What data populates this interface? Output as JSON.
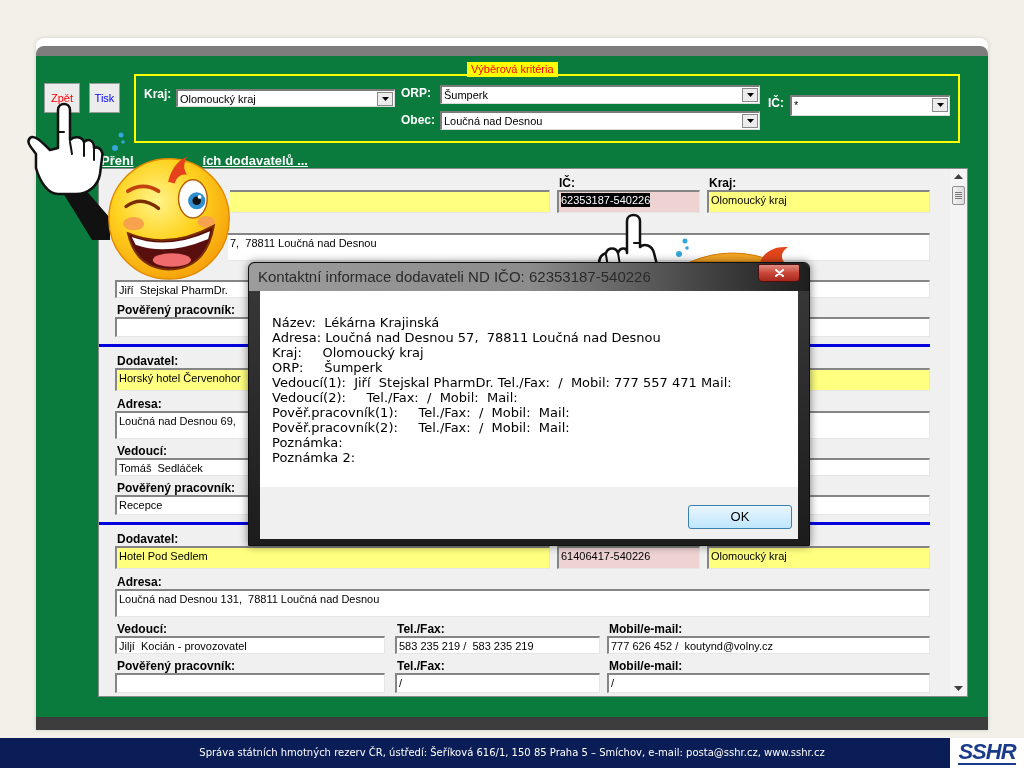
{
  "toolbar": {
    "buttons": [
      {
        "kind": "back",
        "label": "Zpět"
      },
      {
        "kind": "print",
        "label": "Tisk"
      }
    ]
  },
  "criteria": {
    "title": "Výběrová kritéria",
    "filters": [
      {
        "kind": "kraj",
        "label": "Kraj:",
        "value": "Olomoucký kraj"
      },
      {
        "kind": "orp",
        "label": "ORP:",
        "value": "Šumperk"
      },
      {
        "kind": "obec",
        "label": "Obec:",
        "value": "Loučná nad Desnou"
      },
      {
        "kind": "ic",
        "label": "IČ:",
        "value": "*"
      }
    ]
  },
  "list": {
    "heading_parts": [
      "Přehl",
      "ích dodavatelů ..."
    ],
    "records": [
      {
        "fields": [
          {
            "kind": "supplier"
          },
          {
            "kind": "ic",
            "label": "IČ:",
            "value": "62353187-540226",
            "text_selected": true
          },
          {
            "kind": "kraj",
            "label": "Kraj:",
            "value": "Olomoucký kraj"
          },
          {
            "kind": "address",
            "value": "7,  78811 Loučná nad Desnou"
          },
          {
            "kind": "manager",
            "value": "Jiří  Stejskal PharmDr."
          },
          {
            "kind": "mobile"
          },
          {
            "kind": "deputy",
            "label": "Pověřený pracovník:"
          },
          {
            "kind": "deputy_mobile"
          }
        ]
      },
      {
        "fields": [
          {
            "kind": "supplier",
            "label": "Dodavatel:",
            "value": "Horský hotel Červenohor"
          },
          {
            "kind": "kraj"
          },
          {
            "kind": "address",
            "label": "Adresa:",
            "value": "Loučná nad Desnou 69,"
          },
          {
            "kind": "manager",
            "label": "Vedoucí:",
            "value": "Tomáš  Sedláček"
          },
          {
            "kind": "mobile"
          },
          {
            "kind": "deputy",
            "label": "Pověřený pracovník:",
            "value": "Recepce"
          },
          {
            "kind": "deputy_mobile"
          }
        ]
      },
      {
        "fields": [
          {
            "kind": "supplier",
            "label": "Dodavatel:",
            "value": "Hotel Pod Sedlem"
          },
          {
            "kind": "ic",
            "value": "61406417-540226",
            "text_selected": false
          },
          {
            "kind": "kraj",
            "value": "Olomoucký kraj"
          },
          {
            "kind": "address",
            "label": "Adresa:",
            "value": "Loučná nad Desnou 131,  78811 Loučná nad Desnou"
          },
          {
            "kind": "manager",
            "label": "Vedoucí:",
            "value": "Jiljí  Kocián - provozovatel"
          },
          {
            "kind": "tel",
            "label": "Tel./Fax:",
            "value": "583 235 219 /  583 235 219"
          },
          {
            "kind": "mobile",
            "label": "Mobil/e-mail:",
            "value": "777 626 452 /  koutynd@volny.cz"
          },
          {
            "kind": "deputy",
            "label": "Pověřený pracovník:"
          },
          {
            "kind": "deputy_tel",
            "label": "Tel./Fax:",
            "value": "/"
          },
          {
            "kind": "deputy_mobile",
            "label": "Mobil/e-mail:",
            "value": "/"
          }
        ]
      }
    ]
  },
  "dialog": {
    "title": "Kontaktní informace dodavateli ND IČO: 62353187-540226",
    "lines": [
      "Název:  Lékárna Krajinská",
      "Adresa: Loučná nad Desnou 57,  78811 Loučná nad Desnou",
      "Kraj:     Olomoucký kraj",
      "ORP:     Šumperk",
      "Vedoucí(1):  Jiří  Stejskal PharmDr. Tel./Fax:  /  Mobil: 777 557 471 Mail:",
      "Vedoucí(2):     Tel./Fax:  /  Mobil:  Mail:",
      "Pověř.pracovník(1):     Tel./Fax:  /  Mobil:  Mail:",
      "Pověř.pracovník(2):     Tel./Fax:  /  Mobil:  Mail:",
      "Poznámka:",
      "Poznámka 2:"
    ],
    "ok_label": "OK"
  },
  "footer": {
    "text": "Správa státních hmotných rezerv ČR, ústředí: Šeříková 616/1, 150 85 Praha 5 – Smíchov, e-mail: posta@sshr.cz, www.sshr.cz",
    "logo": "SSHR"
  }
}
